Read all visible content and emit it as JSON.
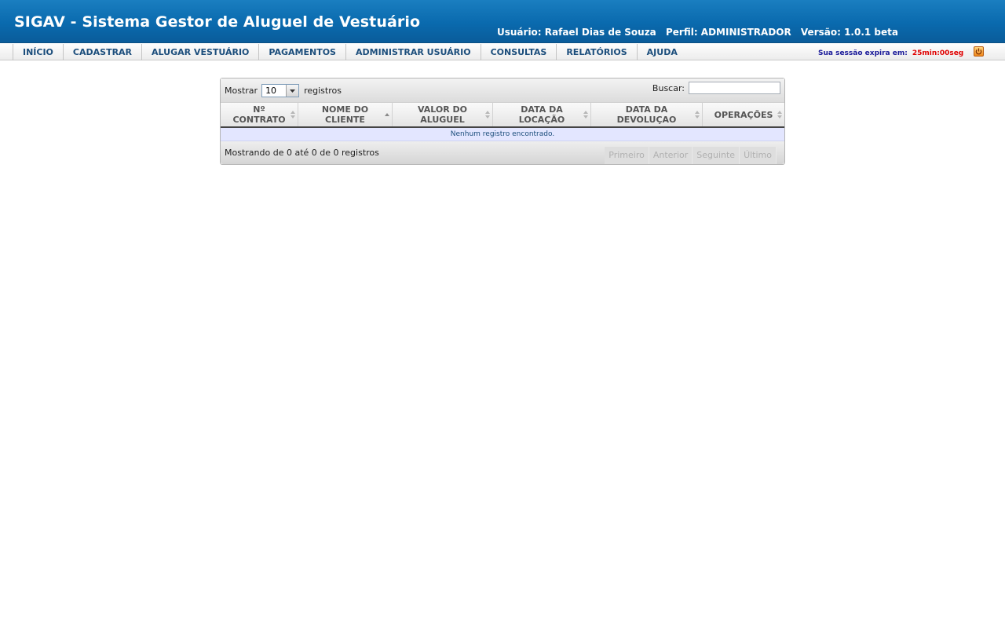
{
  "header": {
    "title": "SIGAV - Sistema Gestor de Aluguel de Vestuário",
    "user": "Usuário: Rafael Dias de Souza",
    "profile": "Perfil: ADMINISTRADOR",
    "version": "Versão: 1.0.1 beta"
  },
  "menu": {
    "items": [
      "INÍCIO",
      "CADASTRAR",
      "ALUGAR VESTUÁRIO",
      "PAGAMENTOS",
      "ADMINISTRAR USUÁRIO",
      "CONSULTAS",
      "RELATÓRIOS",
      "AJUDA"
    ]
  },
  "session": {
    "label": "Sua sessão expira em:",
    "time": "25min:00seg",
    "logout_icon": "power-icon"
  },
  "table": {
    "length_prefix": "Mostrar",
    "length_value": "10",
    "length_suffix": "registros",
    "search_label": "Buscar:",
    "search_value": "",
    "columns": [
      [
        "Nº",
        "CONTRATO"
      ],
      [
        "NOME DO",
        "CLIENTE"
      ],
      [
        "VALOR DO",
        "ALUGUEL"
      ],
      [
        "DATA DA",
        "LOCAÇÃO"
      ],
      [
        "DATA DA",
        "DEVOLUÇAO"
      ],
      [
        "OPERAÇÕES"
      ]
    ],
    "empty_message": "Nenhum registro encontrado.",
    "info": "Mostrando de 0 até 0 de 0 registros",
    "pagination": [
      "Primeiro",
      "Anterior",
      "Seguinte",
      "Último"
    ]
  }
}
